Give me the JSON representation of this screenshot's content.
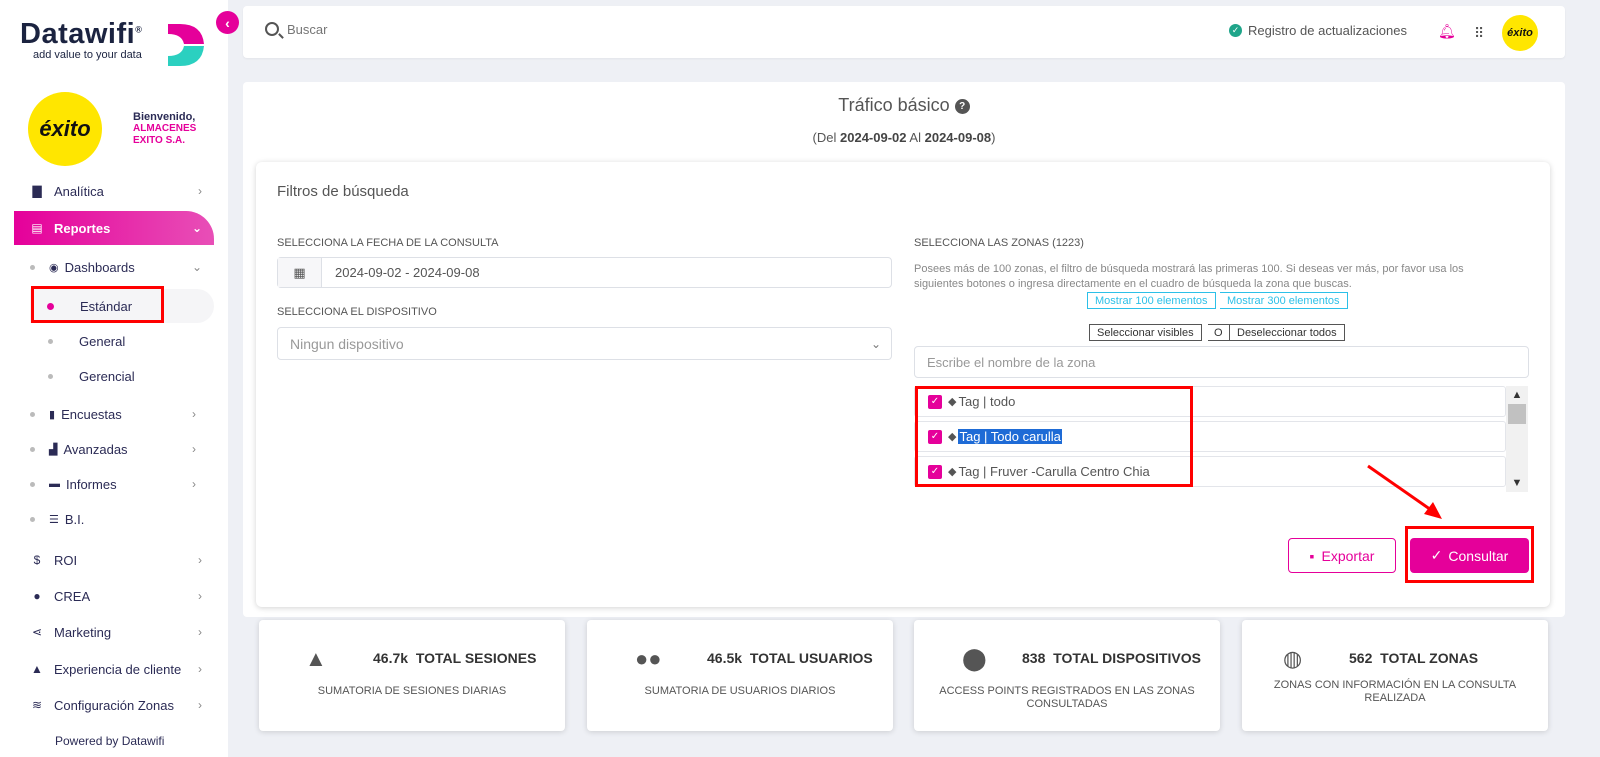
{
  "sidebar": {
    "logo_text": "Datawifi",
    "logo_reg": "®",
    "logo_tagline": "add value to your data",
    "brand_logo_text": "éxito",
    "welcome": "Bienvenido,",
    "company_line1": "ALMACENES",
    "company_line2": "EXITO S.A.",
    "menu": {
      "analitica": "Analítica",
      "reportes": "Reportes",
      "dashboards": "Dashboards",
      "estandar": "Estándar",
      "general": "General",
      "gerencial": "Gerencial",
      "encuestas": "Encuestas",
      "avanzadas": "Avanzadas",
      "informes": "Informes",
      "bi": "B.I.",
      "roi": "ROI",
      "crea": "CREA",
      "marketing": "Marketing",
      "experiencia": "Experiencia de cliente",
      "config_zonas": "Configuración Zonas"
    },
    "powered": "Powered by Datawifi"
  },
  "topbar": {
    "search_placeholder": "Buscar",
    "updates_label": "Registro de actualizaciones",
    "avatar_text": "éxito"
  },
  "page": {
    "title": "Tráfico básico",
    "range_prefix": "(Del",
    "range_start": "2024-09-02",
    "range_mid": "Al",
    "range_end": "2024-09-08",
    "range_suffix": ")"
  },
  "filters": {
    "title": "Filtros de búsqueda",
    "date_label": "SELECCIONA LA FECHA DE LA CONSULTA",
    "date_value": "2024-09-02 - 2024-09-08",
    "device_label": "SELECCIONA EL DISPOSITIVO",
    "device_placeholder": "Ningun dispositivo",
    "zones_label": "SELECCIONA LAS ZONAS (1223)",
    "zones_note": "Posees más de 100 zonas, el filtro de búsqueda mostrará las primeras 100. Si deseas ver más, por favor usa los siguientes botones o ingresa directamente en el cuadro de búsqueda la zona que buscas.",
    "show_100": "Mostrar 100 elementos",
    "show_300": "Mostrar 300 elementos",
    "select_visible": "Seleccionar visibles",
    "or": "O",
    "deselect_all": "Deseleccionar todos",
    "zone_search_placeholder": "Escribe el nombre de la zona",
    "zones": [
      {
        "label": "Tag | todo",
        "checked": true
      },
      {
        "label": "Tag | Todo carulla",
        "checked": true
      },
      {
        "label": "Tag | Fruver -Carulla Centro Chia",
        "checked": true
      }
    ],
    "export_label": "Exportar",
    "query_label": "Consultar"
  },
  "stats": [
    {
      "icon": "thumbs-up-icon",
      "value": "46.7k",
      "label": "TOTAL SESIONES",
      "desc": "SUMATORIA DE SESIONES DIARIAS"
    },
    {
      "icon": "users-icon",
      "value": "46.5k",
      "label": "TOTAL USUARIOS",
      "desc": "SUMATORIA DE USUARIOS DIARIOS"
    },
    {
      "icon": "map-pin-icon",
      "value": "838",
      "label": "TOTAL DISPOSITIVOS",
      "desc": "ACCESS POINTS REGISTRADOS EN LAS ZONAS CONSULTADAS"
    },
    {
      "icon": "globe-icon",
      "value": "562",
      "label": "TOTAL ZONAS",
      "desc": "ZONAS CON INFORMACIÓN EN LA CONSULTA REALIZADA"
    }
  ],
  "colors": {
    "accent": "#e5009a",
    "brand_yellow": "#ffe600",
    "cyan": "#2cc0e8",
    "highlight": "#1e6bd6",
    "annotation_red": "#ff0000"
  }
}
